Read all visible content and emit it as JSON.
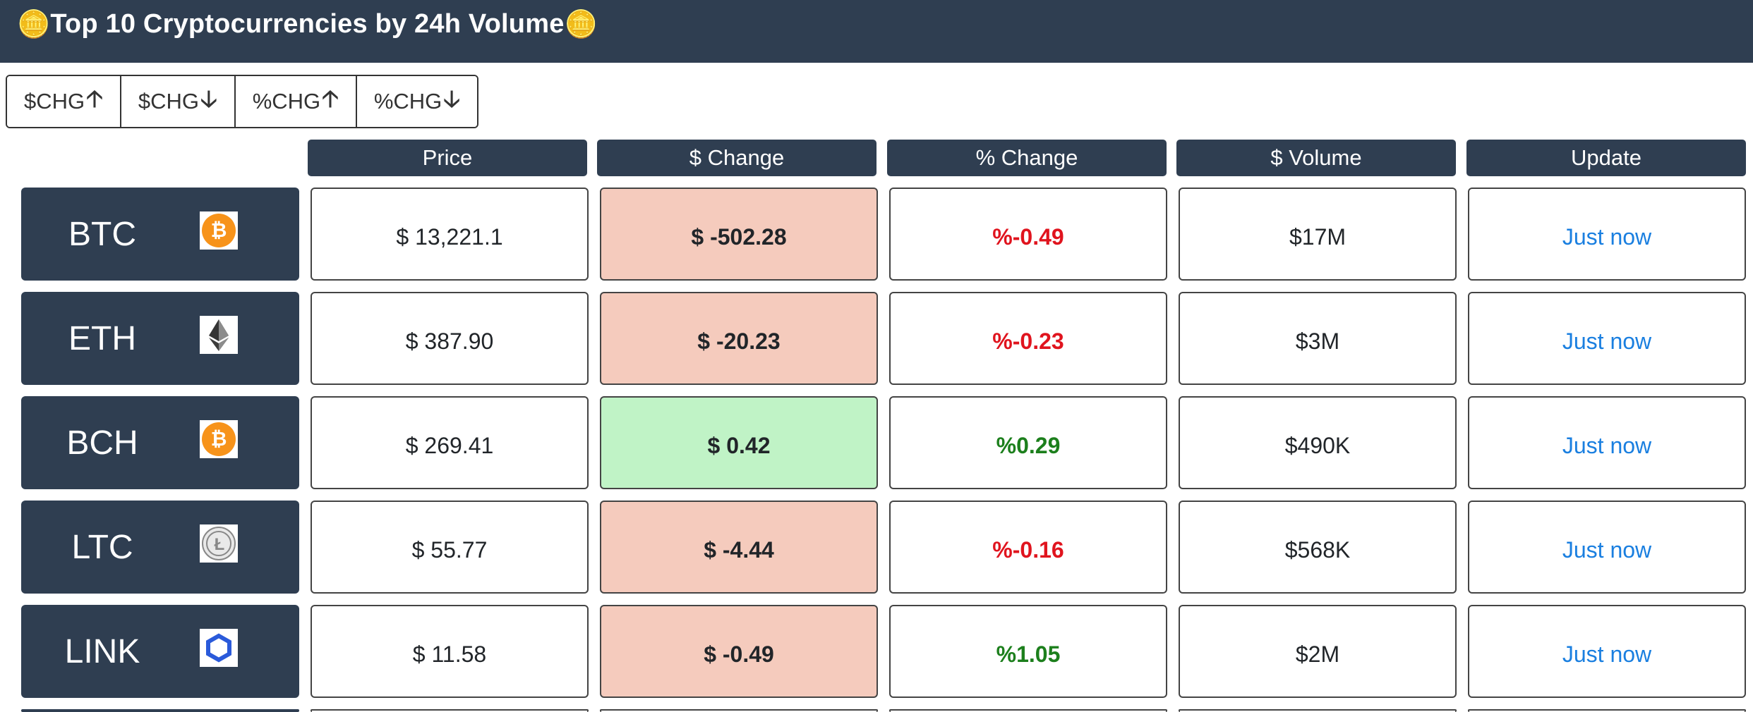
{
  "header": {
    "title": "Top 10 Cryptocurrencies by 24h Volume",
    "icon_left": "coins-icon",
    "icon_right": "coins-icon",
    "icon_glyph": "🪙"
  },
  "sort_buttons": [
    {
      "label": "$CHG",
      "arrow": "🡡"
    },
    {
      "label": "$CHG",
      "arrow": "🡣"
    },
    {
      "label": "%CHG",
      "arrow": "🡡"
    },
    {
      "label": "%CHG",
      "arrow": "🡣"
    }
  ],
  "columns": [
    "Price",
    "$ Change",
    "% Change",
    "$ Volume",
    "Update"
  ],
  "colors": {
    "header_bg": "#2f3e51",
    "negative": "#e0141e",
    "positive": "#1c7f1c",
    "negative_bg": "#f5cbbd",
    "positive_bg": "#c0f3c6",
    "link": "#1a7fe0"
  },
  "rows": [
    {
      "symbol": "BTC",
      "logo": "bitcoin-logo-icon",
      "price": "$ 13,221.1",
      "change": "$ -502.28",
      "pct": "%-0.49",
      "volume": "$17M",
      "update": "Just now",
      "change_dir": "neg",
      "pct_dir": "neg"
    },
    {
      "symbol": "ETH",
      "logo": "ethereum-logo-icon",
      "price": "$ 387.90",
      "change": "$ -20.23",
      "pct": "%-0.23",
      "volume": "$3M",
      "update": "Just now",
      "change_dir": "neg",
      "pct_dir": "neg"
    },
    {
      "symbol": "BCH",
      "logo": "bitcoin-cash-logo-icon",
      "price": "$ 269.41",
      "change": "$ 0.42",
      "pct": "%0.29",
      "volume": "$490K",
      "update": "Just now",
      "change_dir": "pos",
      "pct_dir": "pos"
    },
    {
      "symbol": "LTC",
      "logo": "litecoin-logo-icon",
      "price": "$ 55.77",
      "change": "$ -4.44",
      "pct": "%-0.16",
      "volume": "$568K",
      "update": "Just now",
      "change_dir": "neg",
      "pct_dir": "neg"
    },
    {
      "symbol": "LINK",
      "logo": "chainlink-logo-icon",
      "price": "$ 11.58",
      "change": "$ -0.49",
      "pct": "%1.05",
      "volume": "$2M",
      "update": "Just now",
      "change_dir": "neg",
      "pct_dir": "pos"
    }
  ]
}
